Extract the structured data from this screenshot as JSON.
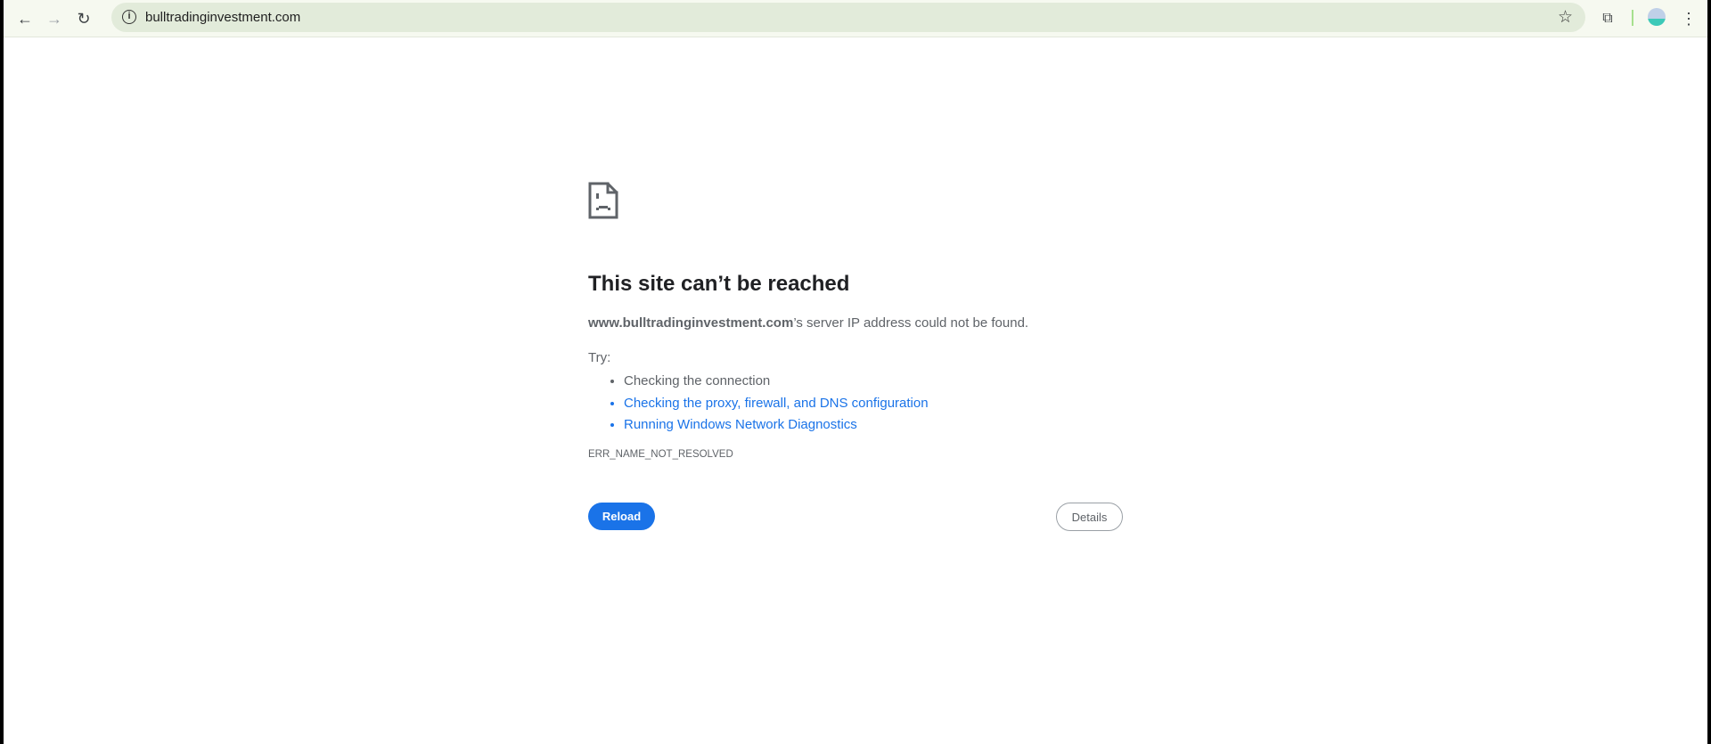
{
  "browser": {
    "url": "bulltradinginvestment.com"
  },
  "error": {
    "title": "This site can’t be reached",
    "host": "www.bulltradinginvestment.com",
    "message": "’s server IP address could not be found.",
    "try_label": "Try:",
    "suggestions": [
      "Checking the connection",
      "Checking the proxy, firewall, and DNS configuration",
      "Running Windows Network Diagnostics"
    ],
    "code": "ERR_NAME_NOT_RESOLVED",
    "reload_label": "Reload",
    "details_label": "Details"
  }
}
